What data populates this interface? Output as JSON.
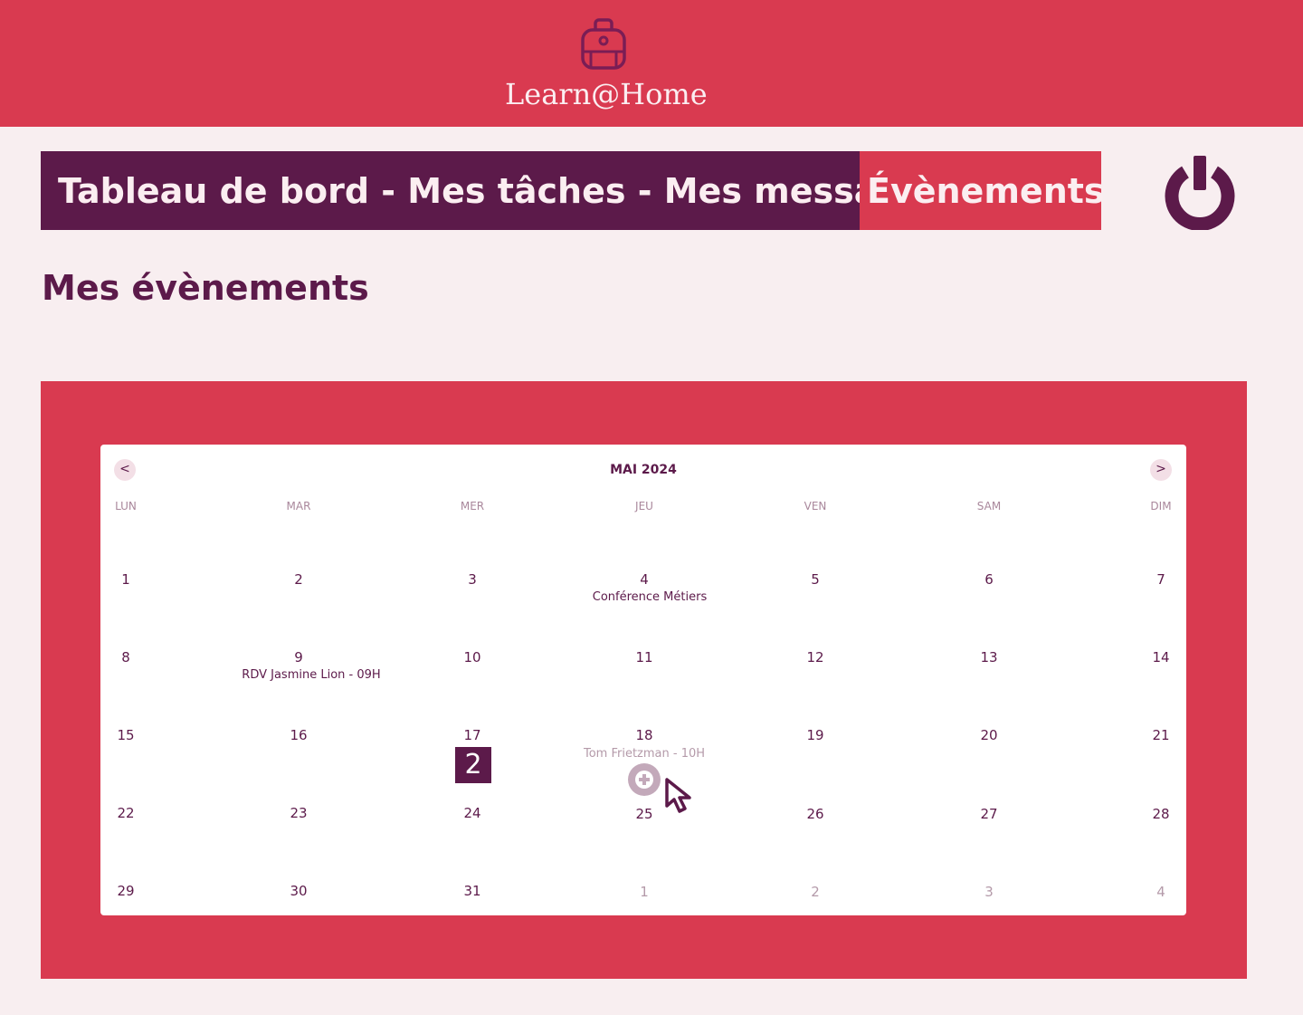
{
  "header": {
    "brand": "Learn@Home",
    "logo_icon": "backpack-icon"
  },
  "nav": {
    "items": [
      "Tableau de bord",
      " - ",
      "Mes tâches",
      " - ",
      "Mes messages",
      " - "
    ],
    "active": "Évènements",
    "logout_icon": "power-icon"
  },
  "page": {
    "title": "Mes évènements"
  },
  "calendar": {
    "month_label": "MAI 2024",
    "prev_label": "<",
    "next_label": ">",
    "weekdays": [
      "LUN",
      "MAR",
      "MER",
      "JEU",
      "VEN",
      "SAM",
      "DIM"
    ],
    "weeks": [
      [
        "1",
        "2",
        "3",
        "4",
        "5",
        "6",
        "7"
      ],
      [
        "8",
        "9",
        "10",
        "11",
        "12",
        "13",
        "14"
      ],
      [
        "15",
        "16",
        "17",
        "18",
        "19",
        "20",
        "21"
      ],
      [
        "22",
        "23",
        "24",
        "25",
        "26",
        "27",
        "28"
      ],
      [
        "29",
        "30",
        "31",
        "1",
        "2",
        "3",
        "4"
      ]
    ],
    "events": {
      "conference": "Conférence Métiers",
      "rdv": "RDV Jasmine Lion - 09H",
      "tom": "Tom Frietzman - 10H"
    },
    "drag_badge": "2"
  },
  "colors": {
    "primary": "#d93a50",
    "secondary": "#5c1a4a",
    "background": "#f8eef0"
  }
}
